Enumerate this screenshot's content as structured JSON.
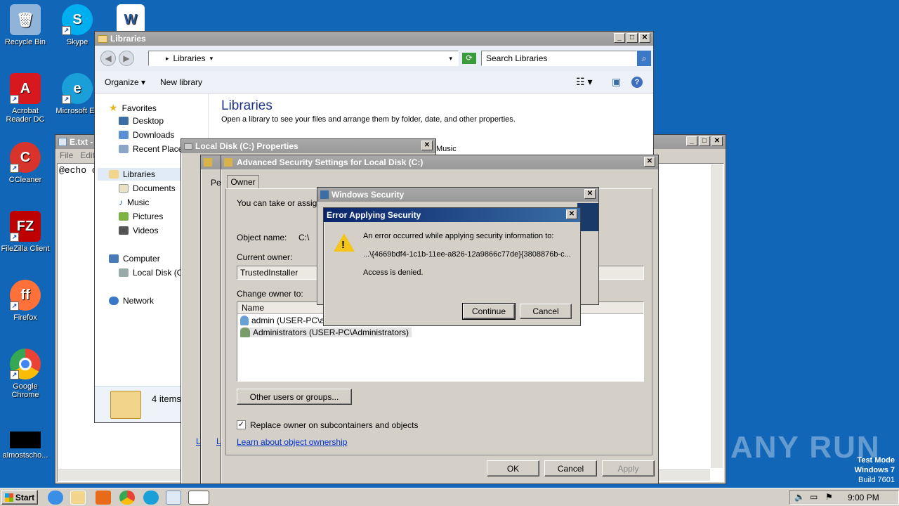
{
  "desktop": {
    "icons": [
      {
        "label": "Recycle Bin",
        "icon": "recycle-bin-icon",
        "color": "#8fb3d9"
      },
      {
        "label": "Skype",
        "icon": "skype-icon",
        "color": "#00aff0"
      },
      {
        "label": "Acrobat Reader DC",
        "icon": "acrobat-icon",
        "color": "#d7191f"
      },
      {
        "label": "Microsoft Ed",
        "icon": "edge-icon",
        "color": "#1a9fd9"
      },
      {
        "label": "CCleaner",
        "icon": "ccleaner-icon",
        "color": "#d9342b"
      },
      {
        "label": "FileZilla Client",
        "icon": "filezilla-icon",
        "color": "#bf0000"
      },
      {
        "label": "Firefox",
        "icon": "firefox-icon",
        "color": "#ff7139"
      },
      {
        "label": "Google Chrome",
        "icon": "chrome-icon",
        "color": "#34a853"
      },
      {
        "label": "almostscho...",
        "icon": "file-icon",
        "color": "#000000"
      }
    ],
    "watermark": "ANY RUN",
    "test_mode": [
      "Test Mode",
      "Windows 7",
      "Build 7601"
    ]
  },
  "libraries": {
    "title": "Libraries",
    "address": "Libraries",
    "search_placeholder": "Search Libraries",
    "toolbar": {
      "organize": "Organize",
      "new_library": "New library"
    },
    "heading": "Libraries",
    "subheading": "Open a library to see your files and arrange them by folder, date, and other properties.",
    "music_label": "Music",
    "nav": {
      "favorites": "Favorites",
      "desktop": "Desktop",
      "downloads": "Downloads",
      "recent": "Recent Places",
      "libraries": "Libraries",
      "documents": "Documents",
      "music": "Music",
      "pictures": "Pictures",
      "videos": "Videos",
      "computer": "Computer",
      "local_disk": "Local Disk (C:)",
      "network": "Network"
    },
    "status": "4 items"
  },
  "notepad": {
    "title": "E.txt -",
    "menu": {
      "file": "File",
      "edit": "Edit"
    },
    "content": "@echo o"
  },
  "properties": {
    "title": "Local Disk (C:) Properties",
    "tab_stub": "Pe"
  },
  "advanced": {
    "title": "Advanced Security Settings for Local Disk (C:)",
    "tab_owner": "Owner",
    "intro": "You can take or assign",
    "object_name_label": "Object name:",
    "object_name_value": "C:\\",
    "current_owner_label": "Current owner:",
    "current_owner_value": "TrustedInstaller",
    "change_owner_label": "Change owner to:",
    "column_name": "Name",
    "owners": [
      "admin (USER-PC\\ad",
      "Administrators (USER-PC\\Administrators)"
    ],
    "other_users_button": "Other users or groups...",
    "replace_checkbox": "Replace owner on subcontainers and objects",
    "learn_link": "Learn about object ownership",
    "ok": "OK",
    "cancel": "Cancel",
    "apply": "Apply"
  },
  "winsec": {
    "title": "Windows Security"
  },
  "error": {
    "title": "Error Applying Security",
    "message": "An error occurred while applying security information to:",
    "path": "...\\{4669bdf4-1c1b-11ee-a826-12a9866c77de}{3808876b-c...",
    "detail": "Access is denied.",
    "continue": "Continue",
    "cancel": "Cancel"
  },
  "taskbar": {
    "start": "Start",
    "time": "9:00 PM"
  }
}
